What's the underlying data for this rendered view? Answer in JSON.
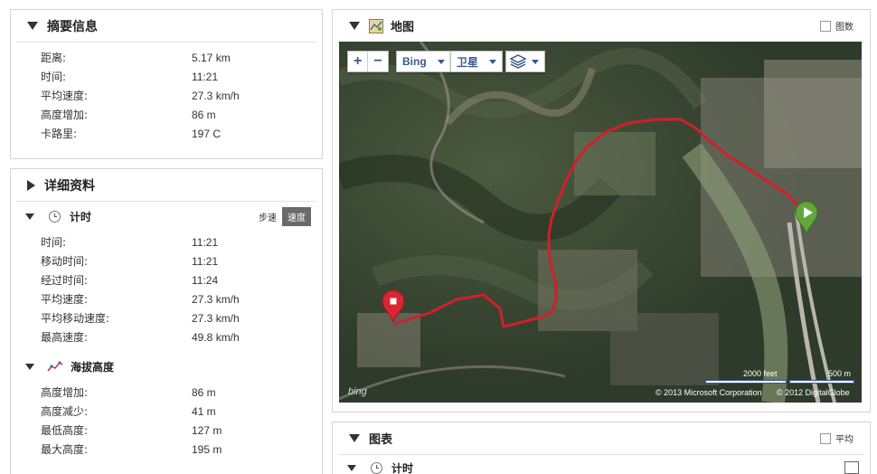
{
  "summary": {
    "title": "摘要信息",
    "rows": [
      {
        "label": "距离:",
        "value": "5.17 km"
      },
      {
        "label": "时间:",
        "value": "11:21"
      },
      {
        "label": "平均速度:",
        "value": "27.3 km/h"
      },
      {
        "label": "高度增加:",
        "value": "86 m"
      },
      {
        "label": "卡路里:",
        "value": "197 C"
      }
    ]
  },
  "details": {
    "title": "详细资料",
    "timing": {
      "title": "计时",
      "toggle_pace": "步速",
      "toggle_speed": "速度",
      "rows": [
        {
          "label": "时间:",
          "value": "11:21"
        },
        {
          "label": "移动时间:",
          "value": "11:21"
        },
        {
          "label": "经过时间:",
          "value": "11:24"
        },
        {
          "label": "平均速度:",
          "value": "27.3 km/h"
        },
        {
          "label": "平均移动速度:",
          "value": "27.3 km/h"
        },
        {
          "label": "最高速度:",
          "value": "49.8 km/h"
        }
      ]
    },
    "elevation": {
      "title": "海拔高度",
      "rows": [
        {
          "label": "高度增加:",
          "value": "86 m"
        },
        {
          "label": "高度减少:",
          "value": "41 m"
        },
        {
          "label": "最低高度:",
          "value": "127 m"
        },
        {
          "label": "最大高度:",
          "value": "195 m"
        }
      ]
    }
  },
  "map": {
    "title": "地图",
    "legend_label": "图数",
    "zoom_in": "+",
    "zoom_out": "−",
    "provider": "Bing",
    "view_mode": "卫星",
    "scale_feet": "2000 feet",
    "scale_m": "500 m",
    "attribution_ms": "© 2013 Microsoft Corporation",
    "attribution_dg": "© 2012 DigitalGlobe",
    "logo": "bing"
  },
  "charts": {
    "title": "图表",
    "average_label": "平均",
    "timing_title": "计时"
  }
}
